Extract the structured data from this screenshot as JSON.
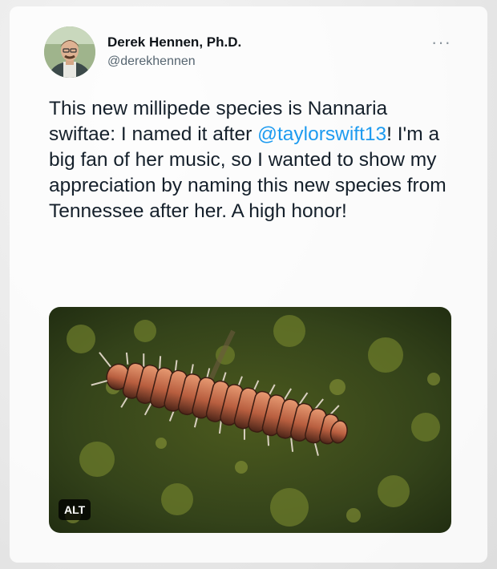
{
  "tweet": {
    "author_name": "Derek Hennen, Ph.D.",
    "handle": "@derekhennen",
    "more_label": "···",
    "text_before": "This new millipede species is Nannaria swiftae: I named it after ",
    "mention": "@taylorswift13",
    "text_after": "! I'm a big fan of her music, so I wanted to show my appreciation by naming this new species from Tennessee after her. A high honor!",
    "media": {
      "alt_badge": "ALT",
      "icon": "millipede-photo"
    }
  },
  "colors": {
    "mention": "#1d9bf0",
    "text": "#15202b",
    "secondary": "#566570"
  }
}
